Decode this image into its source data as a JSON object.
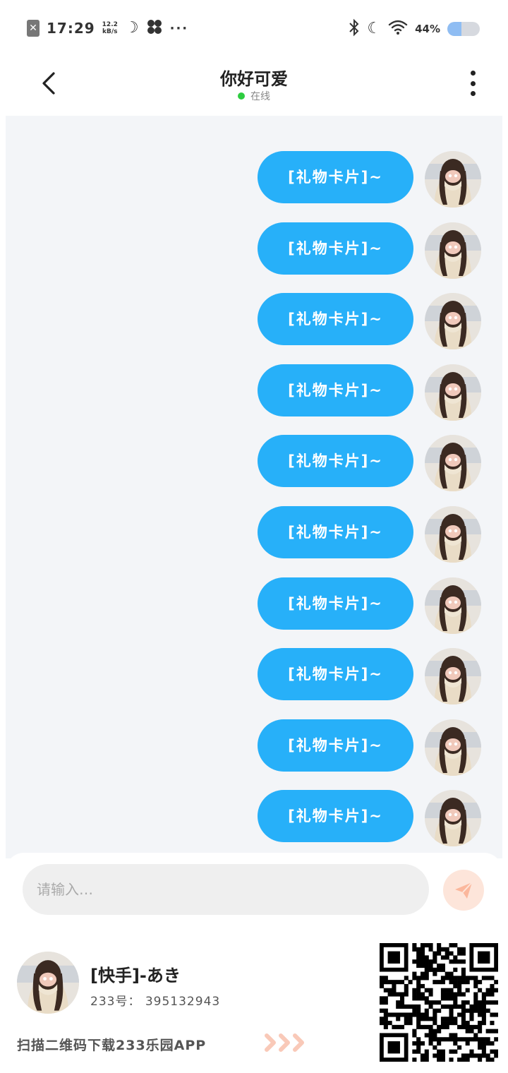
{
  "status_bar": {
    "time": "17:29",
    "speed_value": "12.2",
    "speed_unit": "kB/s",
    "dots": "···",
    "battery_text": "44%",
    "battery_level": 0.44,
    "icons": [
      "close-box-icon",
      "moon-icon",
      "fan-icon",
      "bluetooth-icon",
      "moon-icon",
      "wifi-icon",
      "battery-icon"
    ]
  },
  "header": {
    "title": "你好可爱",
    "status": "在线",
    "status_color": "#2ecc40"
  },
  "chat": {
    "cut_text": "···",
    "bubble_color": "#27b0f9",
    "messages": [
      {
        "text": "[礼物卡片]~"
      },
      {
        "text": "[礼物卡片]~"
      },
      {
        "text": "[礼物卡片]~"
      },
      {
        "text": "[礼物卡片]~"
      },
      {
        "text": "[礼物卡片]~"
      },
      {
        "text": "[礼物卡片]~"
      },
      {
        "text": "[礼物卡片]~"
      },
      {
        "text": "[礼物卡片]~"
      },
      {
        "text": "[礼物卡片]~"
      },
      {
        "text": "[礼物卡片]~"
      }
    ]
  },
  "input": {
    "placeholder": "请输入…",
    "value": ""
  },
  "footer": {
    "name": "[快手]-あき",
    "id_line": "233号： 395132943",
    "scan_text": "扫描二维码下载233乐园APP",
    "accent_color": "#f9c9b8"
  }
}
